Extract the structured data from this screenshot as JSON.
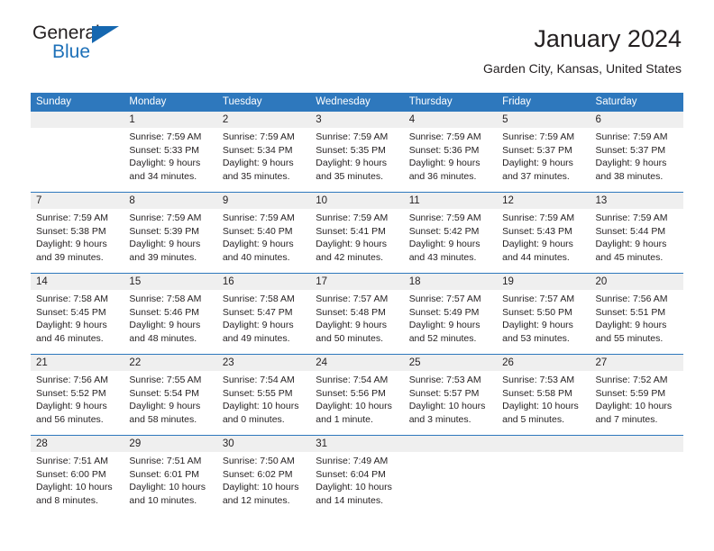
{
  "logo": {
    "word1": "General",
    "word2": "Blue",
    "triangle_color": "#1567b0",
    "blue_text_color": "#1d70b8"
  },
  "header": {
    "title": "January 2024",
    "subtitle": "Garden City, Kansas, United States"
  },
  "calendar": {
    "header_bg": "#2e78bd",
    "daynum_bg": "#efefef",
    "weekdays": [
      "Sunday",
      "Monday",
      "Tuesday",
      "Wednesday",
      "Thursday",
      "Friday",
      "Saturday"
    ],
    "weeks": [
      {
        "days": [
          {
            "num": "",
            "sunrise": "",
            "sunset": "",
            "daylight1": "",
            "daylight2": ""
          },
          {
            "num": "1",
            "sunrise": "Sunrise: 7:59 AM",
            "sunset": "Sunset: 5:33 PM",
            "daylight1": "Daylight: 9 hours",
            "daylight2": "and 34 minutes."
          },
          {
            "num": "2",
            "sunrise": "Sunrise: 7:59 AM",
            "sunset": "Sunset: 5:34 PM",
            "daylight1": "Daylight: 9 hours",
            "daylight2": "and 35 minutes."
          },
          {
            "num": "3",
            "sunrise": "Sunrise: 7:59 AM",
            "sunset": "Sunset: 5:35 PM",
            "daylight1": "Daylight: 9 hours",
            "daylight2": "and 35 minutes."
          },
          {
            "num": "4",
            "sunrise": "Sunrise: 7:59 AM",
            "sunset": "Sunset: 5:36 PM",
            "daylight1": "Daylight: 9 hours",
            "daylight2": "and 36 minutes."
          },
          {
            "num": "5",
            "sunrise": "Sunrise: 7:59 AM",
            "sunset": "Sunset: 5:37 PM",
            "daylight1": "Daylight: 9 hours",
            "daylight2": "and 37 minutes."
          },
          {
            "num": "6",
            "sunrise": "Sunrise: 7:59 AM",
            "sunset": "Sunset: 5:37 PM",
            "daylight1": "Daylight: 9 hours",
            "daylight2": "and 38 minutes."
          }
        ]
      },
      {
        "days": [
          {
            "num": "7",
            "sunrise": "Sunrise: 7:59 AM",
            "sunset": "Sunset: 5:38 PM",
            "daylight1": "Daylight: 9 hours",
            "daylight2": "and 39 minutes."
          },
          {
            "num": "8",
            "sunrise": "Sunrise: 7:59 AM",
            "sunset": "Sunset: 5:39 PM",
            "daylight1": "Daylight: 9 hours",
            "daylight2": "and 39 minutes."
          },
          {
            "num": "9",
            "sunrise": "Sunrise: 7:59 AM",
            "sunset": "Sunset: 5:40 PM",
            "daylight1": "Daylight: 9 hours",
            "daylight2": "and 40 minutes."
          },
          {
            "num": "10",
            "sunrise": "Sunrise: 7:59 AM",
            "sunset": "Sunset: 5:41 PM",
            "daylight1": "Daylight: 9 hours",
            "daylight2": "and 42 minutes."
          },
          {
            "num": "11",
            "sunrise": "Sunrise: 7:59 AM",
            "sunset": "Sunset: 5:42 PM",
            "daylight1": "Daylight: 9 hours",
            "daylight2": "and 43 minutes."
          },
          {
            "num": "12",
            "sunrise": "Sunrise: 7:59 AM",
            "sunset": "Sunset: 5:43 PM",
            "daylight1": "Daylight: 9 hours",
            "daylight2": "and 44 minutes."
          },
          {
            "num": "13",
            "sunrise": "Sunrise: 7:59 AM",
            "sunset": "Sunset: 5:44 PM",
            "daylight1": "Daylight: 9 hours",
            "daylight2": "and 45 minutes."
          }
        ]
      },
      {
        "days": [
          {
            "num": "14",
            "sunrise": "Sunrise: 7:58 AM",
            "sunset": "Sunset: 5:45 PM",
            "daylight1": "Daylight: 9 hours",
            "daylight2": "and 46 minutes."
          },
          {
            "num": "15",
            "sunrise": "Sunrise: 7:58 AM",
            "sunset": "Sunset: 5:46 PM",
            "daylight1": "Daylight: 9 hours",
            "daylight2": "and 48 minutes."
          },
          {
            "num": "16",
            "sunrise": "Sunrise: 7:58 AM",
            "sunset": "Sunset: 5:47 PM",
            "daylight1": "Daylight: 9 hours",
            "daylight2": "and 49 minutes."
          },
          {
            "num": "17",
            "sunrise": "Sunrise: 7:57 AM",
            "sunset": "Sunset: 5:48 PM",
            "daylight1": "Daylight: 9 hours",
            "daylight2": "and 50 minutes."
          },
          {
            "num": "18",
            "sunrise": "Sunrise: 7:57 AM",
            "sunset": "Sunset: 5:49 PM",
            "daylight1": "Daylight: 9 hours",
            "daylight2": "and 52 minutes."
          },
          {
            "num": "19",
            "sunrise": "Sunrise: 7:57 AM",
            "sunset": "Sunset: 5:50 PM",
            "daylight1": "Daylight: 9 hours",
            "daylight2": "and 53 minutes."
          },
          {
            "num": "20",
            "sunrise": "Sunrise: 7:56 AM",
            "sunset": "Sunset: 5:51 PM",
            "daylight1": "Daylight: 9 hours",
            "daylight2": "and 55 minutes."
          }
        ]
      },
      {
        "days": [
          {
            "num": "21",
            "sunrise": "Sunrise: 7:56 AM",
            "sunset": "Sunset: 5:52 PM",
            "daylight1": "Daylight: 9 hours",
            "daylight2": "and 56 minutes."
          },
          {
            "num": "22",
            "sunrise": "Sunrise: 7:55 AM",
            "sunset": "Sunset: 5:54 PM",
            "daylight1": "Daylight: 9 hours",
            "daylight2": "and 58 minutes."
          },
          {
            "num": "23",
            "sunrise": "Sunrise: 7:54 AM",
            "sunset": "Sunset: 5:55 PM",
            "daylight1": "Daylight: 10 hours",
            "daylight2": "and 0 minutes."
          },
          {
            "num": "24",
            "sunrise": "Sunrise: 7:54 AM",
            "sunset": "Sunset: 5:56 PM",
            "daylight1": "Daylight: 10 hours",
            "daylight2": "and 1 minute."
          },
          {
            "num": "25",
            "sunrise": "Sunrise: 7:53 AM",
            "sunset": "Sunset: 5:57 PM",
            "daylight1": "Daylight: 10 hours",
            "daylight2": "and 3 minutes."
          },
          {
            "num": "26",
            "sunrise": "Sunrise: 7:53 AM",
            "sunset": "Sunset: 5:58 PM",
            "daylight1": "Daylight: 10 hours",
            "daylight2": "and 5 minutes."
          },
          {
            "num": "27",
            "sunrise": "Sunrise: 7:52 AM",
            "sunset": "Sunset: 5:59 PM",
            "daylight1": "Daylight: 10 hours",
            "daylight2": "and 7 minutes."
          }
        ]
      },
      {
        "days": [
          {
            "num": "28",
            "sunrise": "Sunrise: 7:51 AM",
            "sunset": "Sunset: 6:00 PM",
            "daylight1": "Daylight: 10 hours",
            "daylight2": "and 8 minutes."
          },
          {
            "num": "29",
            "sunrise": "Sunrise: 7:51 AM",
            "sunset": "Sunset: 6:01 PM",
            "daylight1": "Daylight: 10 hours",
            "daylight2": "and 10 minutes."
          },
          {
            "num": "30",
            "sunrise": "Sunrise: 7:50 AM",
            "sunset": "Sunset: 6:02 PM",
            "daylight1": "Daylight: 10 hours",
            "daylight2": "and 12 minutes."
          },
          {
            "num": "31",
            "sunrise": "Sunrise: 7:49 AM",
            "sunset": "Sunset: 6:04 PM",
            "daylight1": "Daylight: 10 hours",
            "daylight2": "and 14 minutes."
          },
          {
            "num": "",
            "sunrise": "",
            "sunset": "",
            "daylight1": "",
            "daylight2": ""
          },
          {
            "num": "",
            "sunrise": "",
            "sunset": "",
            "daylight1": "",
            "daylight2": ""
          },
          {
            "num": "",
            "sunrise": "",
            "sunset": "",
            "daylight1": "",
            "daylight2": ""
          }
        ]
      }
    ]
  }
}
